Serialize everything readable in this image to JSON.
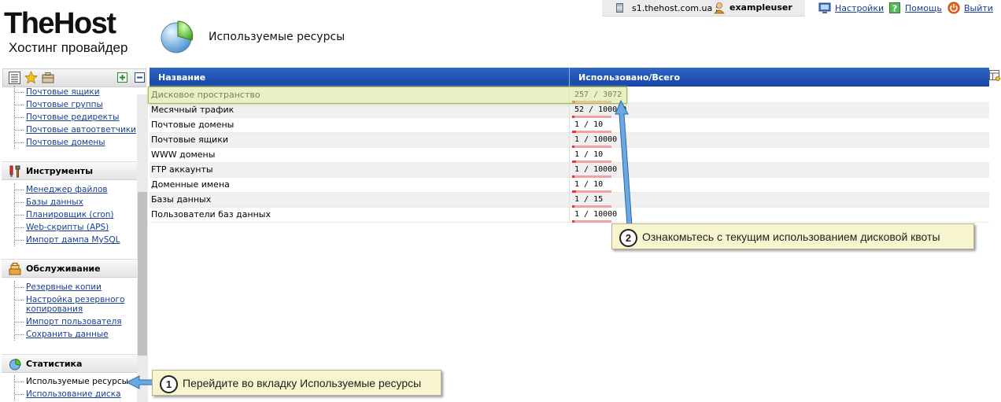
{
  "header": {
    "logo_main": "TheHost",
    "logo_sub": "Хостинг провайдер",
    "page_title": "Используемые ресурсы"
  },
  "topbar": {
    "server": "s1.thehost.com.ua ::",
    "user": "exampleuser",
    "settings": "Настройки",
    "help": "Помощь",
    "logout": "Выйти"
  },
  "sidebar": {
    "mail_items": [
      "Почтовые ящики",
      "Почтовые группы",
      "Почтовые редиректы",
      "Почтовые автоответчики",
      "Почтовые домены"
    ],
    "tools": {
      "title": "Инструменты",
      "items": [
        "Менеджер файлов",
        "Базы данных",
        "Планировщик (cron)",
        "Web-скрипты (APS)",
        "Импорт дампа MySQL"
      ]
    },
    "service": {
      "title": "Обслуживание",
      "items": [
        "Резервные копии",
        "Настройка резервного копирования",
        "Импорт пользователя",
        "Сохранить данные"
      ]
    },
    "stats": {
      "title": "Статистика",
      "items": [
        "Используемые ресурсы",
        "Использование диска"
      ]
    }
  },
  "table": {
    "col_name": "Название",
    "col_usage": "Использовано/Всего",
    "rows": [
      {
        "name": "Дисковое пространство",
        "usage": "257 / 3072",
        "fraction": 0.084
      },
      {
        "name": "Месячный трафик",
        "usage": "52 / 100000",
        "fraction": 0.0005
      },
      {
        "name": "Почтовые домены",
        "usage": "1 / 10",
        "fraction": 0.1
      },
      {
        "name": "Почтовые ящики",
        "usage": "1 / 10000",
        "fraction": 0.0001
      },
      {
        "name": "WWW домены",
        "usage": "1 / 10",
        "fraction": 0.1
      },
      {
        "name": "FTP аккаунты",
        "usage": "1 / 10000",
        "fraction": 0.0001
      },
      {
        "name": "Доменные имена",
        "usage": "1 / 10",
        "fraction": 0.1
      },
      {
        "name": "Базы данных",
        "usage": "1 / 15",
        "fraction": 0.067
      },
      {
        "name": "Пользователи баз данных",
        "usage": "1 / 10000",
        "fraction": 0.0001
      }
    ]
  },
  "callouts": [
    {
      "num": "1",
      "text": "Перейдите во вкладку Используемые ресурсы"
    },
    {
      "num": "2",
      "text": "Ознакомьтесь с текущим использованием дисковой квоты"
    }
  ]
}
